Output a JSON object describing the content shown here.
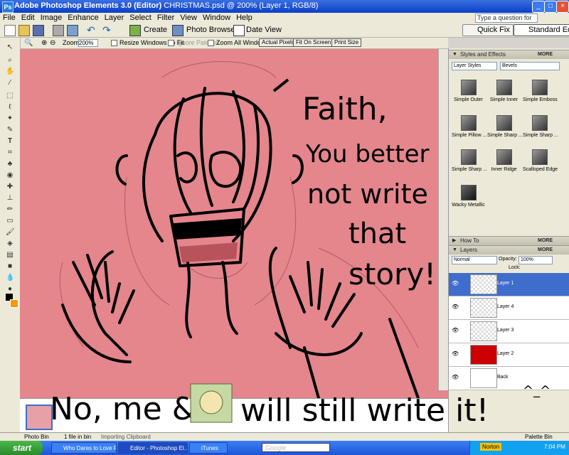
{
  "window": {
    "app_title": "Adobe Photoshop Elements 3.0 (Editor)",
    "doc_title": " CHRISTMAS.psd @ 200% (Layer 1, RGB/8)"
  },
  "menu": [
    "File",
    "Edit",
    "Image",
    "Enhance",
    "Layer",
    "Select",
    "Filter",
    "View",
    "Window",
    "Help"
  ],
  "help_placeholder": "Type a question for help",
  "shortcuts": {
    "create": "Create",
    "photo_browser": "Photo Browser",
    "date_view": "Date View",
    "quick_fix": "Quick Fix",
    "standard_edit": "Standard Edit"
  },
  "options": {
    "zoom_label": "Zoom:",
    "zoom_value": "200%",
    "resize_windows": "Resize Windows To Fit",
    "ignore_palettes": "Ignore Palettes",
    "zoom_all": "Zoom All Windows",
    "actual_pixels": "Actual Pixels",
    "fit_on_screen": "Fit On Screen",
    "print_size": "Print Size"
  },
  "styles_panel": {
    "title": "Styles and Effects",
    "more": "MORE",
    "category": "Layer Styles",
    "subcategory": "Bevels",
    "items": [
      "Simple Outer",
      "Simple Inner",
      "Simple Emboss",
      "Simple Pillow ...",
      "Simple Sharp ...",
      "Simple Sharp ...",
      "Simple Sharp ...",
      "Inner Ridge",
      "Scalloped Edge",
      "Wacky Metallic"
    ]
  },
  "howto_panel": {
    "title": "How To",
    "more": "MORE"
  },
  "layers_panel": {
    "title": "Layers",
    "more": "MORE",
    "blend_mode": "Normal",
    "opacity_label": "Opacity:",
    "opacity_value": "100%",
    "lock_label": "Lock:",
    "layers": [
      {
        "name": "Layer 1",
        "selected": true
      },
      {
        "name": "Layer 4",
        "selected": false
      },
      {
        "name": "Layer 3",
        "selected": false
      },
      {
        "name": "Layer 2",
        "selected": false
      },
      {
        "name": "Back",
        "selected": false
      }
    ]
  },
  "photo_bin": {
    "label": "Photo Bin",
    "count": "1 file in bin",
    "status": "Importing Clipboard",
    "palette_bin": "Palette Bin"
  },
  "taskbar": {
    "start": "start",
    "tasks": [
      "Who Dares to Love F...",
      "Editor - Photoshop El...",
      "iTunes"
    ],
    "search": "Google",
    "norton": "Norton",
    "clock": "7:04 PM"
  },
  "handwriting": {
    "line1": "Faith,",
    "line2": "You better",
    "line3": "not write",
    "line4": "that",
    "line5": "story!",
    "bottom_a": "No, me &",
    "bottom_b": "will still write it!",
    "emote": "^_^"
  },
  "colors": {
    "canvas": "#e4868c",
    "layer2_fill": "#cc0000",
    "selected_layer": "#3f6dcc",
    "titlebar": "#0a3fc7"
  }
}
